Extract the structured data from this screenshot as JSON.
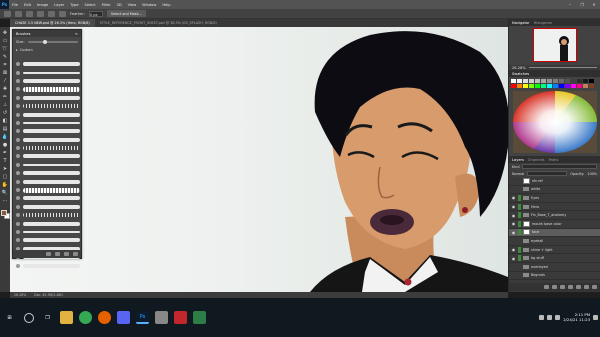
{
  "menu": {
    "items": [
      "File",
      "Edit",
      "Image",
      "Layer",
      "Type",
      "Select",
      "Filter",
      "3D",
      "View",
      "Window",
      "Help"
    ],
    "window_controls": [
      "–",
      "❐",
      "✕"
    ]
  },
  "options_bar": {
    "feather_label": "Feather:",
    "feather_value": "0 px",
    "select_mask_label": "Select and Mask..."
  },
  "document_tabs": [
    {
      "label": "CHASE 3.5 NEW.psd @ 26.3% (Hero, RGB/8)",
      "active": true
    },
    {
      "label": "STYLE_REFERENCE_FRONT_SHEET.psd @ 38.5% (EX_SPLASH, RGB/8)",
      "active": false
    }
  ],
  "brushes_panel": {
    "title": "Brushes",
    "size_label": "Size:",
    "folder_label": "Custom",
    "brush_count": 25
  },
  "navigator": {
    "tabs": [
      "Navigator",
      "Histogram"
    ],
    "zoom": "26.28%"
  },
  "swatches": {
    "tabs": [
      "Swatches"
    ]
  },
  "layers": {
    "tabs": [
      "Layers",
      "Channels",
      "Paths"
    ],
    "filter_label": "Kind",
    "blend_mode": "Normal",
    "opacity_label": "Opacity:",
    "opacity_value": "100%",
    "lock_label": "Lock:",
    "fill_label": "Fill:",
    "fill_value": "100%",
    "items": [
      {
        "name": "sfx ref",
        "type": "layer",
        "visible": false,
        "selected": false
      },
      {
        "name": "white",
        "type": "folder",
        "visible": false,
        "selected": false
      },
      {
        "name": "Eyes",
        "type": "folder",
        "visible": true,
        "selected": false
      },
      {
        "name": "Hero",
        "type": "folder",
        "visible": true,
        "selected": false
      },
      {
        "name": "Fin_Base_T_anatomy",
        "type": "folder",
        "visible": true,
        "selected": false
      },
      {
        "name": "mouth base color",
        "type": "layer",
        "visible": true,
        "selected": false
      },
      {
        "name": "face",
        "type": "layer",
        "visible": true,
        "selected": true
      },
      {
        "name": "eyeball",
        "type": "folder",
        "visible": false,
        "selected": false
      },
      {
        "name": "shine + light",
        "type": "folder",
        "visible": true,
        "selected": false
      },
      {
        "name": "bg stuff",
        "type": "folder",
        "visible": true,
        "selected": false
      },
      {
        "name": "overlayed",
        "type": "folder",
        "visible": false,
        "selected": false
      },
      {
        "name": "Bkgrnds",
        "type": "folder",
        "visible": false,
        "selected": false
      }
    ]
  },
  "status_bar": {
    "zoom": "26.28%",
    "doc_info": "Doc: 45.3M/2.48G"
  },
  "taskbar": {
    "time": "2:11 PM",
    "date": "2/24/21 11:23"
  },
  "colors": {
    "canvas_bg": "#eef1ef",
    "hair": "#0c0c12",
    "skin": "#d79b6c",
    "lips": "#4a2a3a",
    "jacket": "#151515",
    "accent_blue": "#31a8ff"
  }
}
